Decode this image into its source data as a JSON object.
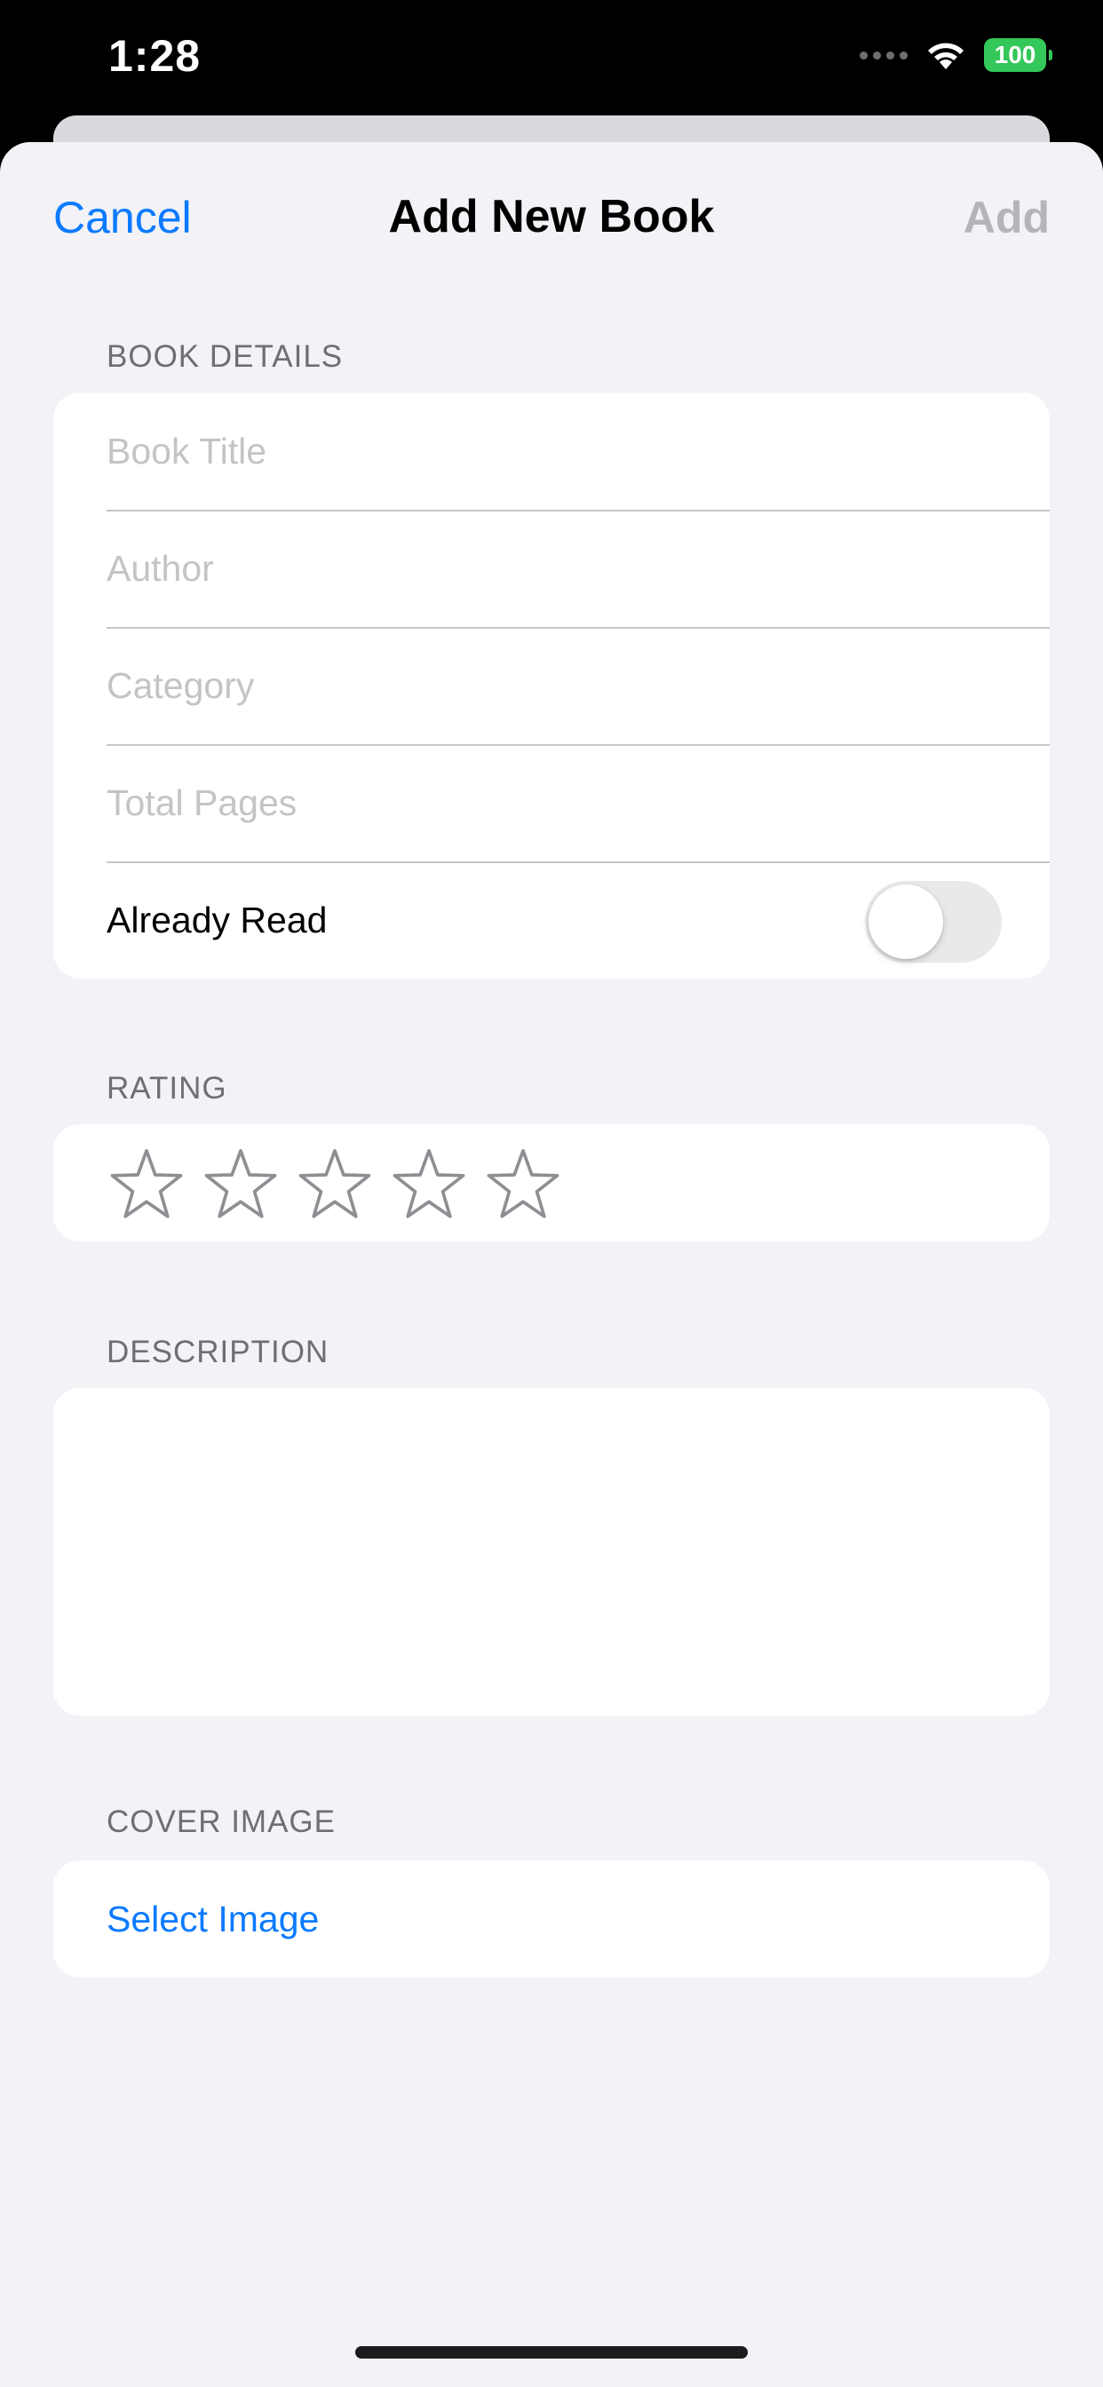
{
  "status_bar": {
    "time": "1:28",
    "battery": "100",
    "icons": [
      "signal-dots-icon",
      "wifi-icon",
      "battery-icon"
    ]
  },
  "nav": {
    "cancel_label": "Cancel",
    "title": "Add New Book",
    "add_label": "Add"
  },
  "book_details": {
    "header": "BOOK DETAILS",
    "fields": [
      {
        "placeholder": "Book Title",
        "value": ""
      },
      {
        "placeholder": "Author",
        "value": ""
      },
      {
        "placeholder": "Category",
        "value": ""
      },
      {
        "placeholder": "Total Pages",
        "value": ""
      }
    ],
    "toggle_label": "Already Read",
    "toggle_on": false
  },
  "rating": {
    "header": "RATING",
    "value": 0,
    "max": 5,
    "icon": "star-outline-icon"
  },
  "description": {
    "header": "DESCRIPTION",
    "value": ""
  },
  "cover_image": {
    "header": "COVER IMAGE",
    "select_label": "Select Image"
  },
  "colors": {
    "accent": "#0a7aff",
    "disabled": "#b4b4b9",
    "background": "#f2f2f7",
    "battery": "#34c759"
  }
}
